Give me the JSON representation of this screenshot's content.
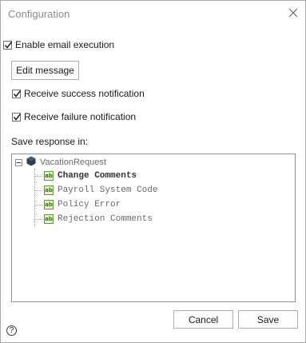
{
  "dialog": {
    "title": "Configuration",
    "close_icon": "close-icon"
  },
  "options": {
    "enable_email": {
      "label": "Enable email execution",
      "checked": true
    },
    "edit_message_label": "Edit message",
    "success_notification": {
      "label": "Receive success notification",
      "checked": true
    },
    "failure_notification": {
      "label": "Receive failure notification",
      "checked": true
    }
  },
  "response": {
    "heading": "Save response in:",
    "tree": {
      "root": {
        "label": "VacationRequest",
        "icon": "cube-icon",
        "expanded": true
      },
      "items": [
        {
          "label": "Change Comments",
          "icon": "ab-field-icon",
          "selected": true
        },
        {
          "label": "Payroll System Code",
          "icon": "ab-field-icon",
          "selected": false
        },
        {
          "label": "Policy Error",
          "icon": "ab-field-icon",
          "selected": false
        },
        {
          "label": "Rejection Comments",
          "icon": "ab-field-icon",
          "selected": false
        }
      ]
    }
  },
  "footer": {
    "cancel_label": "Cancel",
    "save_label": "Save",
    "help_symbol": "?"
  },
  "colors": {
    "field_icon_border": "#5a9a3a",
    "field_icon_fill": "#e4f3c4",
    "title_text": "#8a8a8a"
  }
}
